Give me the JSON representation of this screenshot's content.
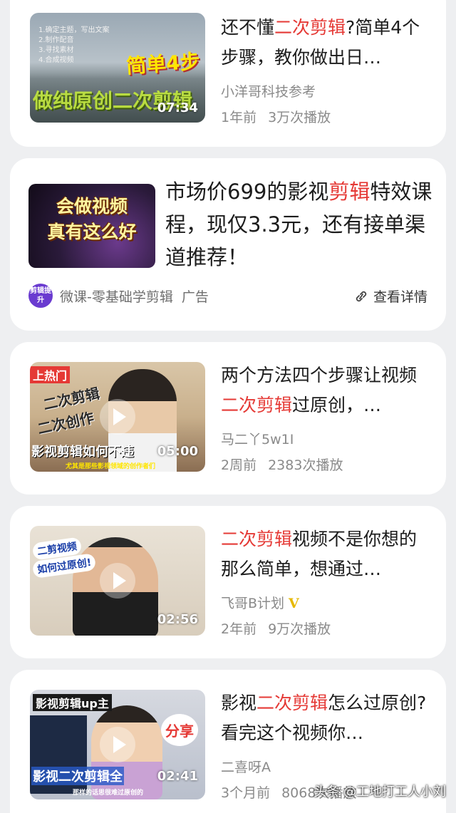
{
  "feed": [
    {
      "title_parts": [
        "还不懂",
        "二次剪辑",
        "?简单4个步骤，教你做出日…"
      ],
      "author": "小洋哥科技参考",
      "age": "1年前",
      "plays": "3万次播放",
      "thumb": {
        "steps": [
          "1.确定主题，写出文案",
          "2.制作配音",
          "3.寻找素材",
          "4.合成视频"
        ],
        "badge": "简单4步",
        "banner": "做纯原创二次剪辑",
        "duration": "07:34"
      }
    },
    {
      "title_parts": [
        "两个方法四个步骤让视频",
        "二次剪辑",
        "过原创，…"
      ],
      "author": "马二丫5w1I",
      "age": "2周前",
      "plays": "2383次播放",
      "thumb": {
        "corner": "上热门",
        "side1": "二次剪辑",
        "side2": "二次创作",
        "banner": "影视剪辑如何不违",
        "sub": "尤其是那些影视领域的创作者们",
        "duration": "05:00"
      }
    },
    {
      "title_parts": [
        "",
        "二次剪辑",
        "视频不是你想的那么简单，想通过…"
      ],
      "author": "飞哥B计划",
      "verified": "V",
      "age": "2年前",
      "plays": "9万次播放",
      "thumb": {
        "bubble1": "二剪视频",
        "bubble2": "如何过原创!",
        "duration": "02:56"
      }
    },
    {
      "title_parts": [
        "影视",
        "二次剪辑",
        "怎么过原创?看完这个视频你…"
      ],
      "author": "二喜呀A",
      "age": "3个月前",
      "plays": "8068次播放",
      "thumb": {
        "top": "影视剪辑up主",
        "bubble": "分享",
        "banner": "影视二次剪辑全",
        "sub": "那样的话思很难过原创的",
        "duration": "02:41"
      }
    }
  ],
  "ad": {
    "thumb_line1": "会做视频",
    "thumb_line2": "真有这么好",
    "title_parts": [
      "市场价699的影视",
      "剪辑",
      "特效课程，现仅3.3元，还有接单渠道推荐！"
    ],
    "logo_text": "剪辑提升",
    "source": "微课-零基础学剪辑",
    "tag": "广告",
    "link_label": "查看详情",
    "link_icon": "link-icon"
  },
  "watermark": "头条 @工地打工人小刘",
  "colors": {
    "highlight": "#e53935",
    "page_bg": "#eeeff1",
    "card_bg": "#ffffff",
    "meta_text": "#8a8a8a",
    "verified": "#e6b800"
  }
}
